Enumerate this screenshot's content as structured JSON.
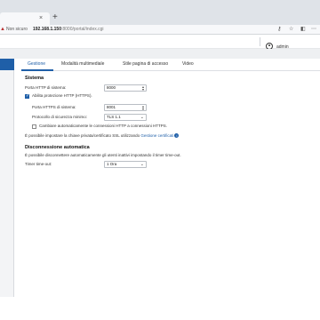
{
  "browser": {
    "tab_close": "×",
    "new_tab": "+",
    "not_secure": "Non sicuro",
    "url_host": "192.168.1.150",
    "url_rest": ":8000/portal/index.cgi",
    "icons": [
      "key-icon",
      "star-icon",
      "extensions-icon",
      "menu-icon"
    ]
  },
  "appbar": {
    "username": "admin"
  },
  "tabs": [
    {
      "label": "Gestione",
      "active": true
    },
    {
      "label": "Modalità multimediale",
      "active": false
    },
    {
      "label": "Stile pagina di accesso",
      "active": false
    },
    {
      "label": "Video",
      "active": false
    }
  ],
  "system": {
    "title": "Sistema",
    "http_port_label": "Porta HTTP di sistema:",
    "http_port_value": "8000",
    "https_enable_label": "Abilita protezione HTTP (HTTPS).",
    "https_enable_checked": true,
    "https_port_label": "Porta HTTPS di sistema:",
    "https_port_value": "8001",
    "tls_label": "Protocollo di sicurezza minimo:",
    "tls_value": "TLS 1.1",
    "redirect_label": "Cambiare automaticamente le connessioni HTTP a connessioni HTTPS.",
    "redirect_checked": false,
    "cert_note": "È possibile impostare la chiave privata/certificato SSL utilizzando",
    "cert_link": "Gestione certificati",
    "cert_info": "i"
  },
  "logout": {
    "title": "Disconnessione automatica",
    "note": "È possibile disconnettere automaticamente gli utenti inattivi impostando il timer time-out.",
    "timer_label": "Timer time-out:",
    "timer_value": "1 Ora"
  },
  "colors": {
    "accent": "#1f5fa8",
    "chrome": "#dfe3e8"
  }
}
